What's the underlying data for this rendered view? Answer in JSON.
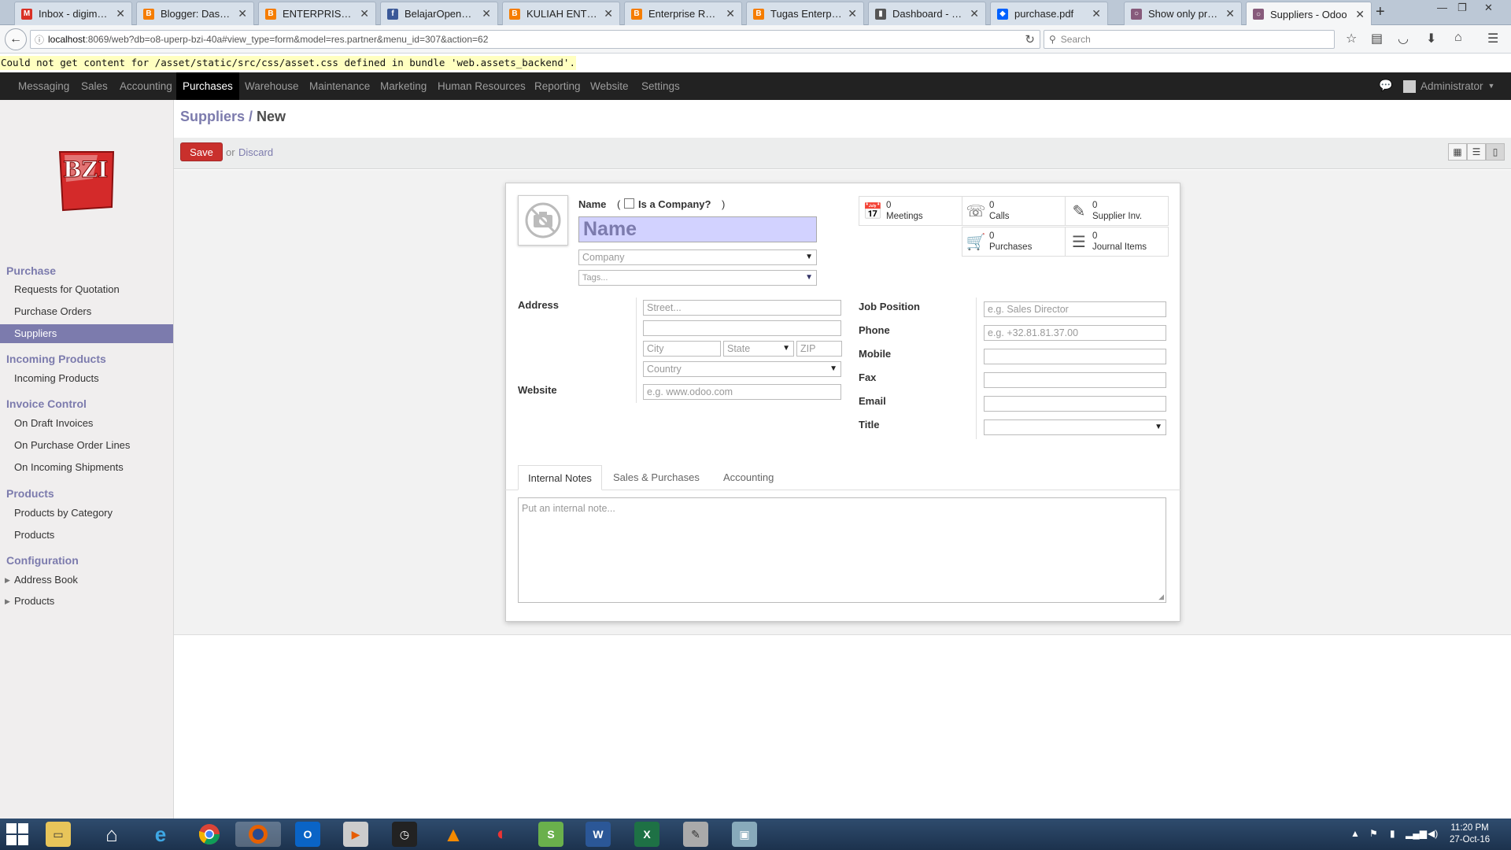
{
  "browser": {
    "tabs": [
      {
        "label": "Inbox - digimon...",
        "color": "#d93025",
        "glyph": "M"
      },
      {
        "label": "Blogger: Dasbor...",
        "color": "#f57d00",
        "glyph": "B"
      },
      {
        "label": "ENTERPRISE RE...",
        "color": "#f57d00",
        "glyph": "B"
      },
      {
        "label": "BelajarOpenERP",
        "color": "#3b5998",
        "glyph": "f"
      },
      {
        "label": "KULIAH ENTER...",
        "color": "#f57d00",
        "glyph": "B"
      },
      {
        "label": "Enterprise Reso...",
        "color": "#f57d00",
        "glyph": "B"
      },
      {
        "label": "Tugas Enterpris...",
        "color": "#f57d00",
        "glyph": "B"
      },
      {
        "label": "Dashboard - Git...",
        "color": "#555555",
        "glyph": "▮"
      },
      {
        "label": "purchase.pdf",
        "color": "#0061fe",
        "glyph": "◆"
      },
      {
        "label": "Show only prod...",
        "color": "#875a7b",
        "glyph": "○"
      },
      {
        "label": "Suppliers - Odoo",
        "color": "#875a7b",
        "glyph": "○"
      }
    ],
    "url_host": "localhost",
    "url_rest": ":8069/web?db=o8-uperp-bzi-40a#view_type=form&model=res.partner&menu_id=307&action=62",
    "search_placeholder": "Search"
  },
  "warning": "Could not get content for /asset/static/src/css/asset.css defined in bundle 'web.assets_backend'.",
  "topmenu": {
    "items": [
      "Messaging",
      "Sales",
      "Accounting",
      "Purchases",
      "Warehouse",
      "Maintenance",
      "Marketing",
      "Human Resources",
      "Reporting",
      "Website",
      "Settings"
    ],
    "active": "Purchases",
    "user": "Administrator"
  },
  "sidebar": {
    "logo_text": "BZI",
    "sections": [
      {
        "title": "Purchase",
        "items": [
          "Requests for Quotation",
          "Purchase Orders",
          "Suppliers"
        ]
      },
      {
        "title": "Incoming Products",
        "items": [
          "Incoming Products"
        ]
      },
      {
        "title": "Invoice Control",
        "items": [
          "On Draft Invoices",
          "On Purchase Order Lines",
          "On Incoming Shipments"
        ]
      },
      {
        "title": "Products",
        "items": [
          "Products by Category",
          "Products"
        ]
      },
      {
        "title": "Configuration",
        "items": [
          "Address Book",
          "Products"
        ]
      }
    ],
    "active_item": "Suppliers"
  },
  "breadcrumb": {
    "parent": "Suppliers",
    "sep": " / ",
    "current": "New"
  },
  "actions": {
    "save": "Save",
    "or": "or",
    "discard": "Discard"
  },
  "form": {
    "name_label": "Name",
    "is_company_open": "(",
    "is_company_label": "Is a Company?",
    "is_company_close": ")",
    "name_placeholder": "Name",
    "company_placeholder": "Company",
    "tags_placeholder": "Tags...",
    "stat_buttons": [
      {
        "value": "0",
        "label": "Meetings",
        "icon": "calendar-icon"
      },
      {
        "value": "0",
        "label": "Calls",
        "icon": "phone-icon"
      },
      {
        "value": "0",
        "label": "Supplier Inv.",
        "icon": "edit-icon"
      },
      {
        "value": "0",
        "label": "Purchases",
        "icon": "cart-icon"
      },
      {
        "value": "0",
        "label": "Journal Items",
        "icon": "list-icon"
      }
    ],
    "address_label": "Address",
    "street_placeholder": "Street...",
    "city_placeholder": "City",
    "state_placeholder": "State",
    "zip_placeholder": "ZIP",
    "country_placeholder": "Country",
    "website_label": "Website",
    "website_placeholder": "e.g. www.odoo.com",
    "job_position_label": "Job Position",
    "job_position_placeholder": "e.g. Sales Director",
    "phone_label": "Phone",
    "phone_placeholder": "e.g. +32.81.81.37.00",
    "mobile_label": "Mobile",
    "fax_label": "Fax",
    "email_label": "Email",
    "title_label": "Title",
    "tabs": [
      "Internal Notes",
      "Sales & Purchases",
      "Accounting"
    ],
    "notes_placeholder": "Put an internal note..."
  },
  "taskbar": {
    "time": "11:20 PM",
    "date": "27-Oct-16"
  },
  "colors": {
    "accent": "#7c7bad",
    "save": "#c9302c",
    "topbar": "#222222"
  }
}
